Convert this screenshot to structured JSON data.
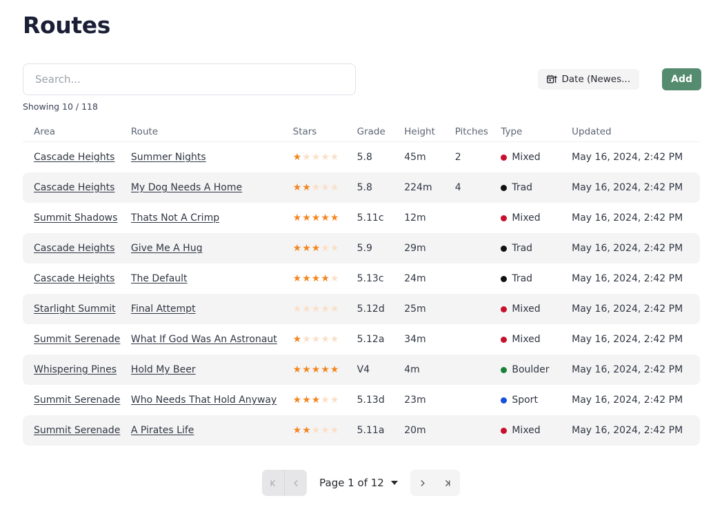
{
  "header": {
    "title": "Routes"
  },
  "search": {
    "value": "",
    "placeholder": "Search..."
  },
  "status": {
    "showing": "Showing 10 / 118"
  },
  "toolbar": {
    "sort_label": "Date (Newes...",
    "sort_icon": "calendar-sort-ascending-icon",
    "add_label": "Add",
    "add_color": "#558b6e"
  },
  "table": {
    "columns": [
      "Area",
      "Route",
      "Stars",
      "Grade",
      "Height",
      "Pitches",
      "Type",
      "Updated"
    ],
    "type_colors": {
      "Mixed": "#c8102e",
      "Trad": "#111111",
      "Boulder": "#1a8139",
      "Sport": "#1750dd"
    },
    "rows": [
      {
        "area": "Cascade Heights",
        "route": "Summer Nights",
        "stars": 1,
        "grade": "5.8",
        "height": "45m",
        "pitches": "2",
        "type": "Mixed",
        "updated": "May 16, 2024, 2:42 PM"
      },
      {
        "area": "Cascade Heights",
        "route": "My Dog Needs A Home",
        "stars": 2,
        "grade": "5.8",
        "height": "224m",
        "pitches": "4",
        "type": "Trad",
        "updated": "May 16, 2024, 2:42 PM"
      },
      {
        "area": "Summit Shadows",
        "route": "Thats Not A Crimp",
        "stars": 5,
        "grade": "5.11c",
        "height": "12m",
        "pitches": "",
        "type": "Mixed",
        "updated": "May 16, 2024, 2:42 PM"
      },
      {
        "area": "Cascade Heights",
        "route": "Give Me A Hug",
        "stars": 3,
        "grade": "5.9",
        "height": "29m",
        "pitches": "",
        "type": "Trad",
        "updated": "May 16, 2024, 2:42 PM"
      },
      {
        "area": "Cascade Heights",
        "route": "The Default",
        "stars": 4,
        "grade": "5.13c",
        "height": "24m",
        "pitches": "",
        "type": "Trad",
        "updated": "May 16, 2024, 2:42 PM"
      },
      {
        "area": "Starlight Summit",
        "route": "Final Attempt",
        "stars": 0,
        "grade": "5.12d",
        "height": "25m",
        "pitches": "",
        "type": "Mixed",
        "updated": "May 16, 2024, 2:42 PM"
      },
      {
        "area": "Summit Serenade",
        "route": "What If God Was An Astronaut",
        "stars": 1,
        "grade": "5.12a",
        "height": "34m",
        "pitches": "",
        "type": "Mixed",
        "updated": "May 16, 2024, 2:42 PM"
      },
      {
        "area": "Whispering Pines",
        "route": "Hold My Beer",
        "stars": 5,
        "grade": "V4",
        "height": "4m",
        "pitches": "",
        "type": "Boulder",
        "updated": "May 16, 2024, 2:42 PM"
      },
      {
        "area": "Summit Serenade",
        "route": "Who Needs That Hold Anyway",
        "stars": 3,
        "grade": "5.13d",
        "height": "23m",
        "pitches": "",
        "type": "Sport",
        "updated": "May 16, 2024, 2:42 PM"
      },
      {
        "area": "Summit Serenade",
        "route": "A Pirates Life",
        "stars": 2,
        "grade": "5.11a",
        "height": "20m",
        "pitches": "",
        "type": "Mixed",
        "updated": "May 16, 2024, 2:42 PM"
      }
    ]
  },
  "pagination": {
    "first_label": "|<",
    "prev_label": "‹",
    "page_label": "Page 1 of 12",
    "next_label": "›",
    "last_label": ">|",
    "current_page": 1,
    "total_pages": 12
  }
}
